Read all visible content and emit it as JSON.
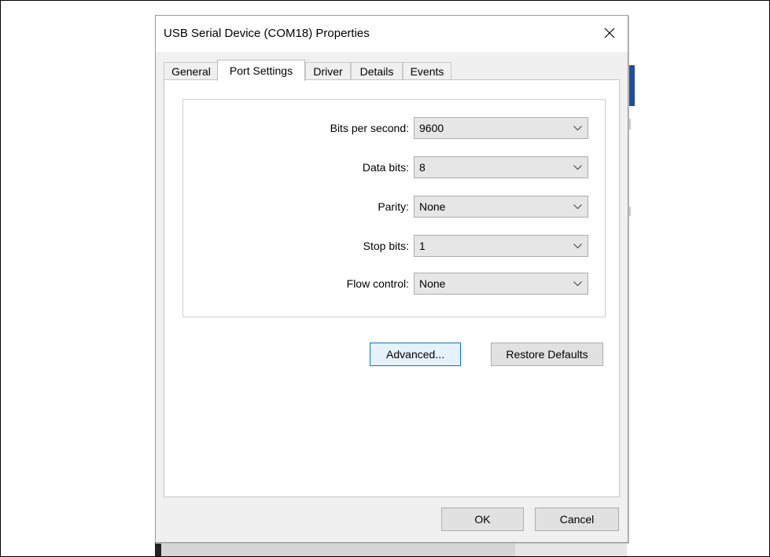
{
  "dialog": {
    "title": "USB Serial Device (COM18) Properties"
  },
  "tabs": [
    {
      "label": "General"
    },
    {
      "label": "Port Settings"
    },
    {
      "label": "Driver"
    },
    {
      "label": "Details"
    },
    {
      "label": "Events"
    }
  ],
  "port_settings": {
    "bits_per_second": {
      "label": "Bits per second:",
      "value": "9600"
    },
    "data_bits": {
      "label": "Data bits:",
      "value": "8"
    },
    "parity": {
      "label": "Parity:",
      "value": "None"
    },
    "stop_bits": {
      "label": "Stop bits:",
      "value": "1"
    },
    "flow_control": {
      "label": "Flow control:",
      "value": "None"
    }
  },
  "buttons": {
    "advanced": "Advanced...",
    "restore_defaults": "Restore Defaults",
    "ok": "OK",
    "cancel": "Cancel"
  },
  "icons": {
    "close": "close-icon",
    "dropdown": "chevron-down-icon"
  },
  "colors": {
    "focus_border": "#0078d7",
    "dialog_bg": "#f0f0f0"
  }
}
